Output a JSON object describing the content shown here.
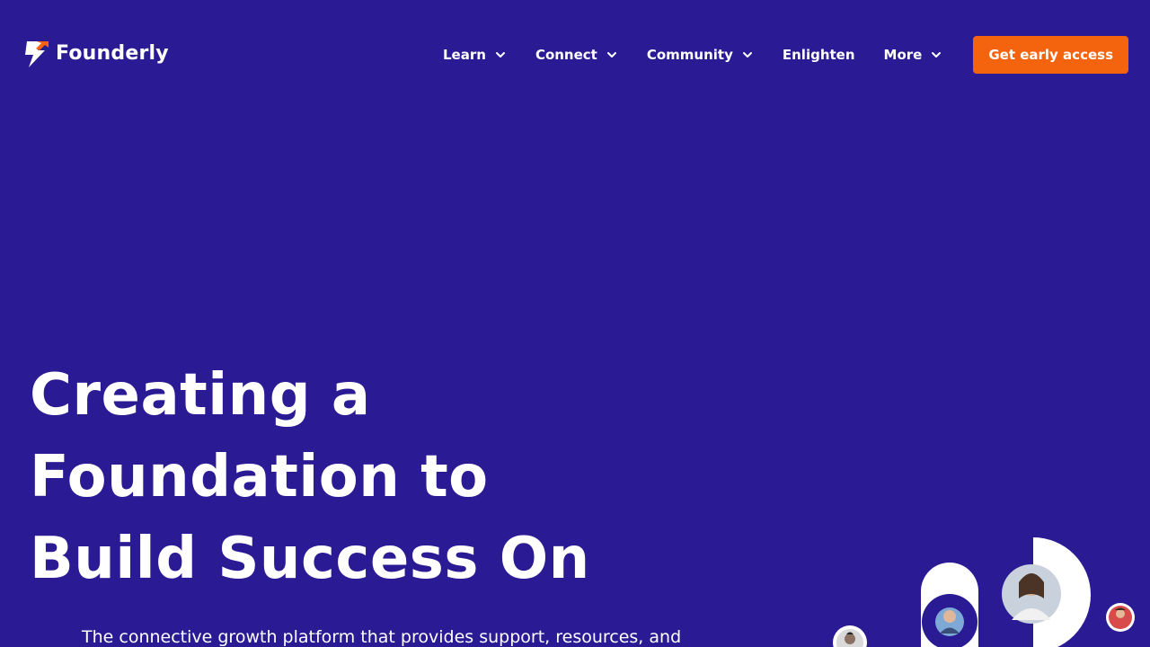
{
  "brand": {
    "name": "Founderly",
    "logo_icon": "lightning-bolt-icon",
    "accent_color": "#f4640f",
    "background_color": "#2a1a93"
  },
  "nav": {
    "items": [
      {
        "label": "Learn",
        "has_dropdown": true
      },
      {
        "label": "Connect",
        "has_dropdown": true
      },
      {
        "label": "Community",
        "has_dropdown": true
      },
      {
        "label": "Enlighten",
        "has_dropdown": false
      },
      {
        "label": "More",
        "has_dropdown": true
      }
    ],
    "cta_label": "Get early access"
  },
  "hero": {
    "title_lines": [
      "Creating a",
      "Foundation to",
      "Build Success On"
    ],
    "subtitle": "The connective growth platform that provides support, resources, and"
  }
}
